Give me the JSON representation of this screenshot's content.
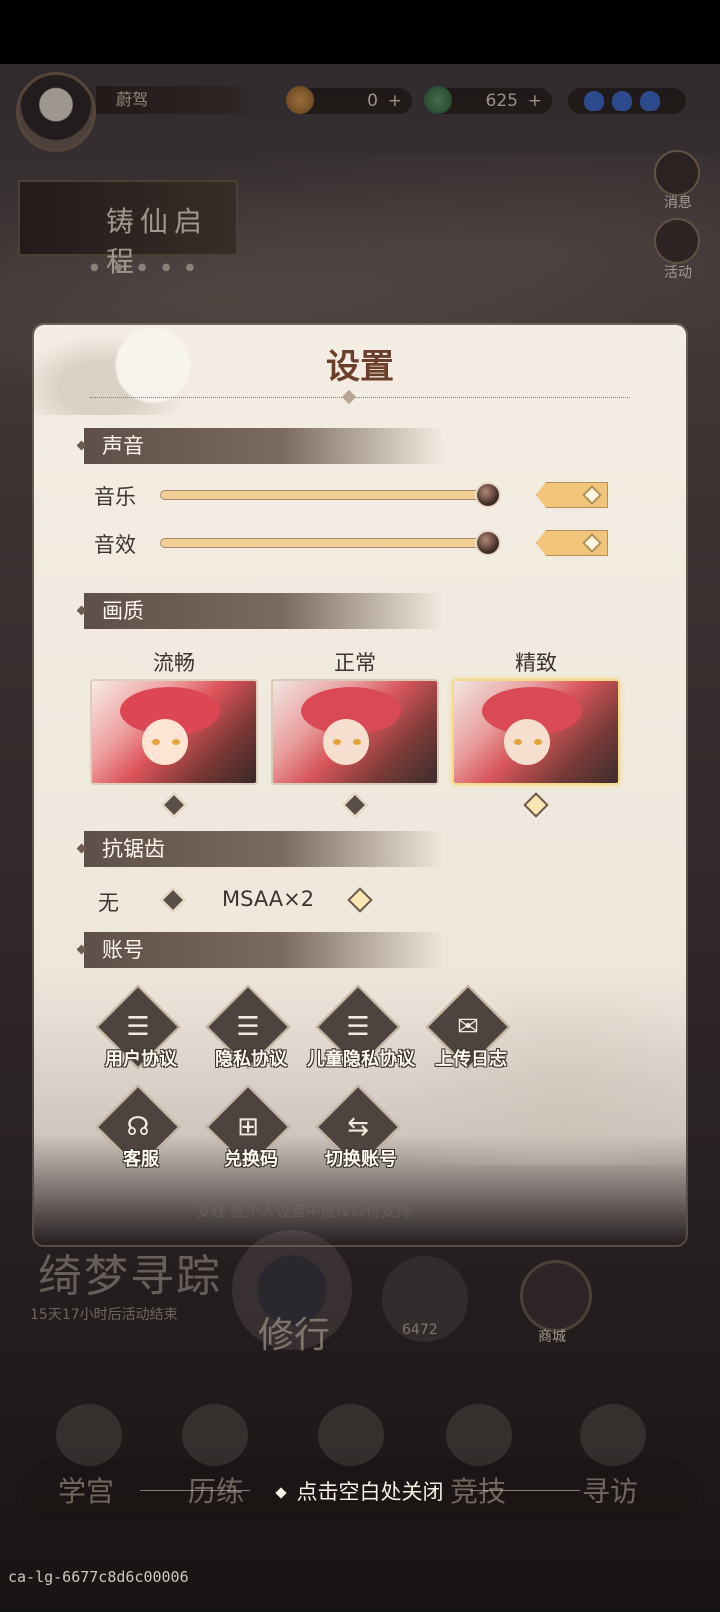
{
  "hud": {
    "player_name": "蔚驾",
    "coins": "0",
    "jade": "625",
    "plus": "+"
  },
  "side_buttons": [
    {
      "label": "消息"
    },
    {
      "label": "活动"
    }
  ],
  "banner": {
    "title": "铸仙启程"
  },
  "dialog": {
    "title": "设置",
    "sound": {
      "section": "声音",
      "music_label": "音乐",
      "sfx_label": "音效",
      "music_volume": 1.0,
      "sfx_volume": 1.0,
      "music_on": true,
      "sfx_on": true
    },
    "quality": {
      "section": "画质",
      "options": [
        {
          "label": "流畅",
          "selected": false
        },
        {
          "label": "正常",
          "selected": false
        },
        {
          "label": "精致",
          "selected": true
        }
      ]
    },
    "antialias": {
      "section": "抗锯齿",
      "options": [
        {
          "label": "无",
          "selected": false
        },
        {
          "label": "MSAA×2",
          "selected": true
        }
      ]
    },
    "account": {
      "section": "账号",
      "buttons": [
        {
          "label": "用户协议",
          "icon": "document-icon"
        },
        {
          "label": "隐私协议",
          "icon": "document-icon"
        },
        {
          "label": "儿童隐私协议",
          "icon": "document-icon"
        },
        {
          "label": "上传日志",
          "icon": "envelope-icon"
        },
        {
          "label": "客服",
          "icon": "headset-icon"
        },
        {
          "label": "兑换码",
          "icon": "gift-icon"
        },
        {
          "label": "切换账号",
          "icon": "switch-icon"
        }
      ]
    },
    "background_hint": "支线 任个人设置中提校以付支持"
  },
  "bottom": {
    "event_title": "绮梦寻踪",
    "event_timer": "15天17小时后活动结束",
    "xiuxing": "修行",
    "seal_number": "6472",
    "shop": "商城",
    "nav": [
      "学宫",
      "历练",
      "",
      "竞技",
      "寻访"
    ],
    "close_hint": "点击空白处关闭"
  },
  "footer_id": "ca-lg-6677c8d6c00006",
  "colors": {
    "panel_bg": "#f4ede3",
    "title": "#6b3f2c",
    "section_bar": "#5e4f48",
    "slider_fill": "#f3cf98",
    "toggle_on": "#f1c57a"
  }
}
